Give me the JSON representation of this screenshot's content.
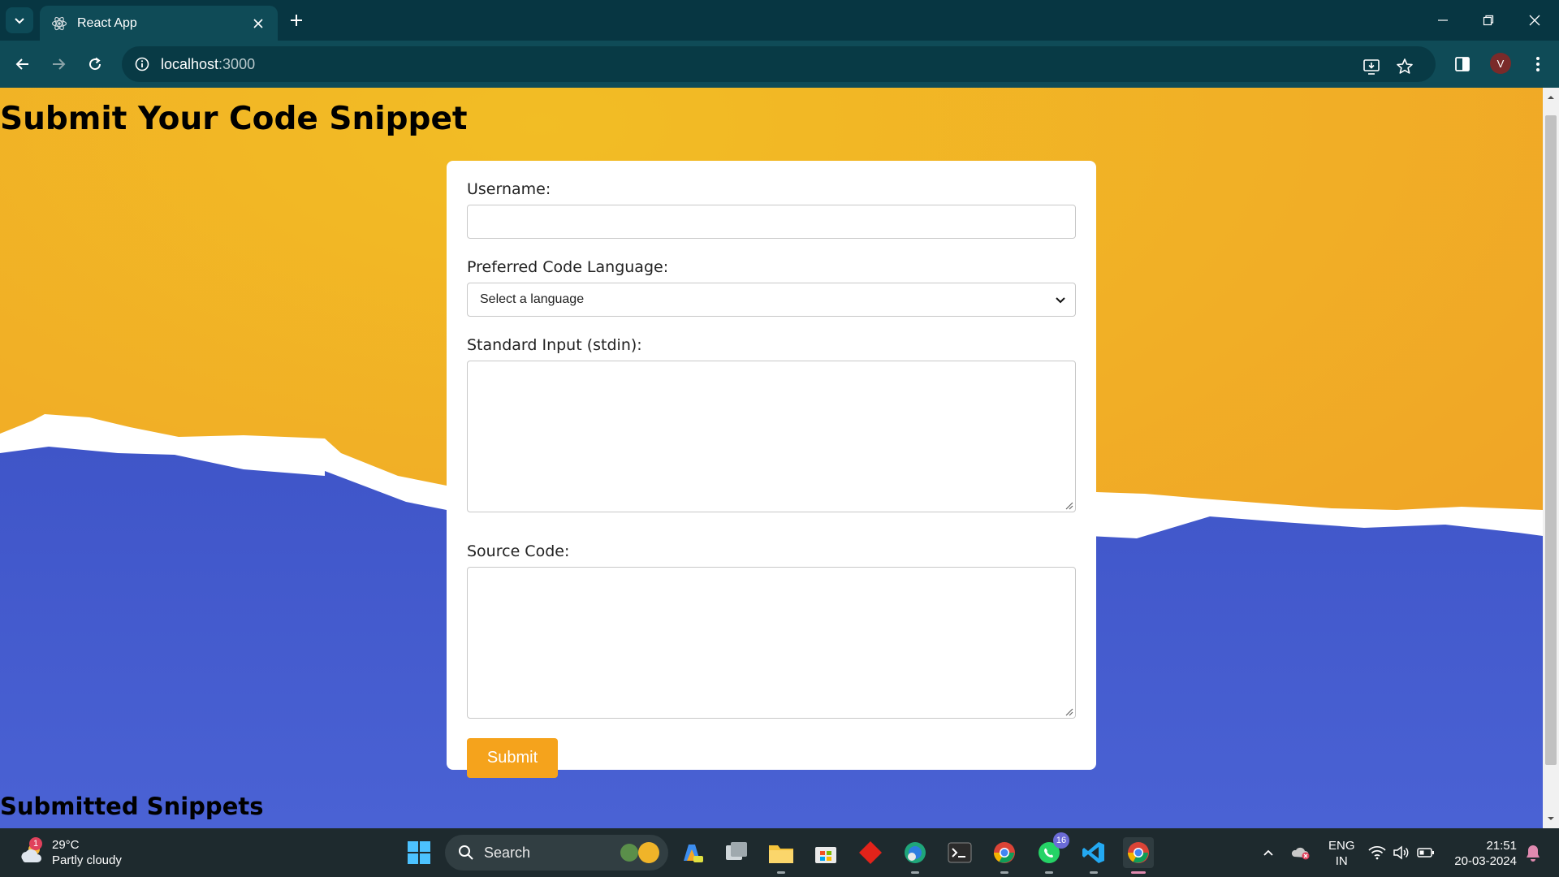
{
  "browser": {
    "tab_title": "React App",
    "url_host": "localhost",
    "url_port": ":3000",
    "profile_initial": "V"
  },
  "page": {
    "heading": "Submit Your Code Snippet",
    "form": {
      "username_label": "Username:",
      "username_value": "",
      "language_label": "Preferred Code Language:",
      "language_selected": "Select a language",
      "stdin_label": "Standard Input (stdin):",
      "stdin_value": "",
      "source_label": "Source Code:",
      "source_value": "",
      "submit_label": "Submit"
    },
    "submitted_heading": "Submitted Snippets"
  },
  "taskbar": {
    "weather_temp": "29°C",
    "weather_desc": "Partly cloudy",
    "weather_badge": "1",
    "search_label": "Search",
    "whatsapp_badge": "16",
    "lang_line1": "ENG",
    "lang_line2": "IN",
    "time": "21:51",
    "date": "20-03-2024"
  },
  "colors": {
    "chrome_bg": "#073642",
    "accent_orange": "#f5a31c",
    "bg_blue": "#4459c8"
  }
}
